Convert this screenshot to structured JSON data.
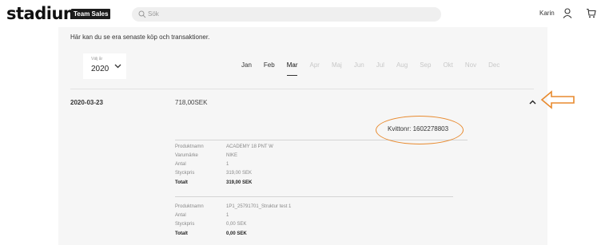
{
  "header": {
    "logo_text": "stadium",
    "badge_text": "Team Sales",
    "search_placeholder": "Sök",
    "user_name": "Karin",
    "icons": {
      "search": "search-icon",
      "user": "user-icon",
      "cart": "cart-icon"
    }
  },
  "intro_text": "Här kan du se era senaste köp och transaktioner.",
  "year_select": {
    "label": "Välj år",
    "value": "2020"
  },
  "months": [
    {
      "label": "Jan",
      "state": "enabled"
    },
    {
      "label": "Feb",
      "state": "enabled"
    },
    {
      "label": "Mar",
      "state": "active"
    },
    {
      "label": "Apr",
      "state": "disabled"
    },
    {
      "label": "Maj",
      "state": "disabled"
    },
    {
      "label": "Jun",
      "state": "disabled"
    },
    {
      "label": "Jul",
      "state": "disabled"
    },
    {
      "label": "Aug",
      "state": "disabled"
    },
    {
      "label": "Sep",
      "state": "disabled"
    },
    {
      "label": "Okt",
      "state": "disabled"
    },
    {
      "label": "Nov",
      "state": "disabled"
    },
    {
      "label": "Dec",
      "state": "disabled"
    }
  ],
  "transaction": {
    "date": "2020-03-23",
    "amount": "718,00SEK",
    "receipt": "Kvittonr: 1602278803",
    "items": [
      {
        "rows": [
          {
            "label": "Produktnamn",
            "value": "ACADEMY 18 PNT W"
          },
          {
            "label": "Varumärke",
            "value": "NIKE"
          },
          {
            "label": "Antal",
            "value": "1"
          },
          {
            "label": "Styckpris",
            "value": "319,00 SEK"
          },
          {
            "label": "Totalt",
            "value": "319,00 SEK"
          }
        ]
      },
      {
        "rows": [
          {
            "label": "Produktnamn",
            "value": "1P1_25791701_Struktur test 1"
          },
          {
            "label": "Antal",
            "value": "1"
          },
          {
            "label": "Styckpris",
            "value": "0,00 SEK"
          },
          {
            "label": "Totalt",
            "value": "0,00 SEK"
          }
        ]
      }
    ]
  },
  "colors": {
    "annotation": "#e88a2e",
    "panel": "#f6f6f6",
    "badge": "#1c1c1c"
  }
}
